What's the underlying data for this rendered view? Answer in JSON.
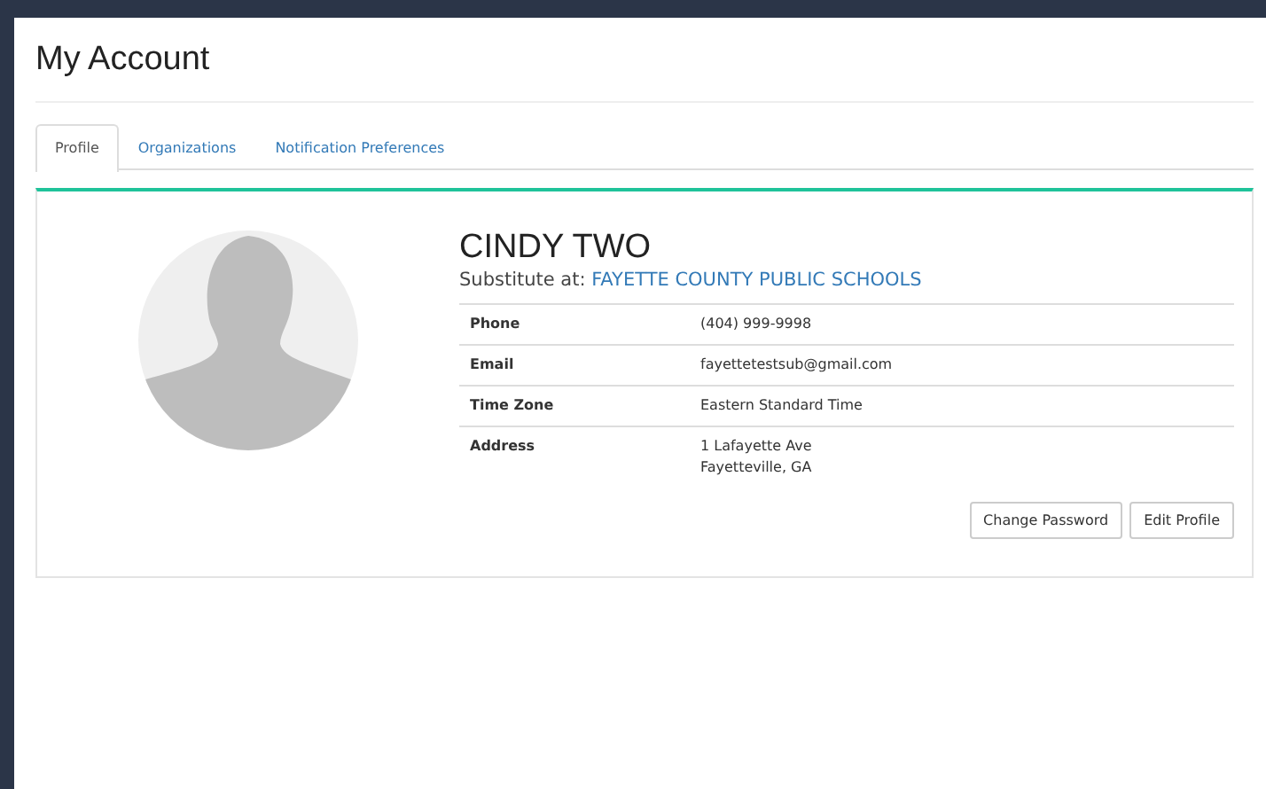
{
  "page": {
    "title": "My Account"
  },
  "tabs": [
    {
      "label": "Profile",
      "selected": true
    },
    {
      "label": "Organizations",
      "selected": false
    },
    {
      "label": "Notification Preferences",
      "selected": false
    }
  ],
  "profile": {
    "name": "CINDY TWO",
    "role_label": "Substitute at:",
    "organization": "FAYETTE COUNTY PUBLIC SCHOOLS",
    "details": [
      {
        "label": "Phone",
        "lines": [
          "(404) 999-9998"
        ]
      },
      {
        "label": "Email",
        "lines": [
          "fayettetestsub@gmail.com"
        ]
      },
      {
        "label": "Time Zone",
        "lines": [
          "Eastern Standard Time"
        ]
      },
      {
        "label": "Address",
        "lines": [
          "1 Lafayette Ave",
          "Fayetteville, GA"
        ]
      }
    ],
    "buttons": [
      "Change Password",
      "Edit Profile"
    ]
  }
}
